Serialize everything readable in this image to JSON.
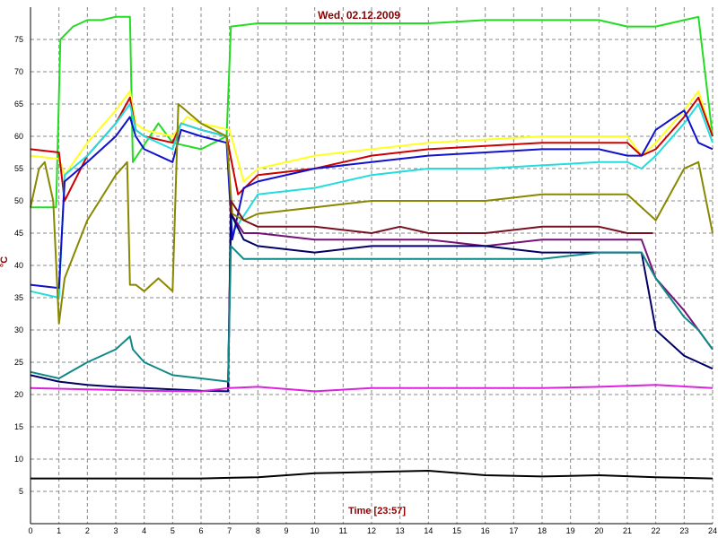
{
  "chart_data": {
    "type": "line",
    "title": "Wed, 02.12.2009",
    "xlabel": "Time [23:57]",
    "ylabel": "°C",
    "xlim": [
      0,
      24
    ],
    "ylim": [
      0,
      80
    ],
    "xticks": [
      "0",
      "1",
      "2",
      "3",
      "4",
      "5",
      "6",
      "7",
      "8",
      "9",
      "10",
      "11",
      "12",
      "13",
      "14",
      "15",
      "16",
      "17",
      "18",
      "19",
      "20",
      "21",
      "22",
      "23",
      "24"
    ],
    "yticks": [
      "5",
      "10",
      "15",
      "20",
      "25",
      "30",
      "35",
      "40",
      "45",
      "50",
      "55",
      "60",
      "65",
      "70",
      "75"
    ],
    "grid": true,
    "series": [
      {
        "color": "#22dd22",
        "x": [
          0,
          0.9,
          1.05,
          1.5,
          2,
          2.5,
          3,
          3.5,
          3.6,
          4.5,
          5,
          6,
          6.9,
          7.05,
          8,
          10,
          12,
          14,
          16,
          18,
          20,
          21,
          21.5,
          22,
          23,
          23.5,
          24
        ],
        "y": [
          49,
          49,
          75,
          77,
          78,
          78,
          78.5,
          78.5,
          56,
          62,
          59,
          58,
          60,
          77,
          77.5,
          77.5,
          77.5,
          77.5,
          78,
          78,
          78,
          77,
          77,
          77,
          78,
          78.5,
          60
        ]
      },
      {
        "color": "#ffff22",
        "x": [
          0,
          1,
          1.2,
          2,
          3,
          3.5,
          3.7,
          4,
          5,
          5.5,
          6,
          7,
          7.5,
          8,
          10,
          12,
          14,
          16,
          18,
          20,
          21,
          21.5,
          22,
          23,
          23.5,
          24
        ],
        "y": [
          57,
          56.5,
          54,
          59,
          64,
          67,
          62,
          61,
          60,
          63,
          62,
          61,
          53,
          55,
          57,
          58,
          59,
          59.5,
          60,
          60,
          60,
          57,
          59,
          64,
          67,
          60
        ]
      },
      {
        "color": "#cc0000",
        "x": [
          0,
          1,
          1.2,
          2,
          3,
          3.5,
          3.7,
          4,
          5,
          5.3,
          6,
          6.9,
          7.3,
          8,
          10,
          12,
          14,
          16,
          18,
          20,
          21,
          21.5,
          22,
          23,
          23.5,
          24
        ],
        "y": [
          58,
          57.5,
          50,
          57,
          62,
          66,
          61,
          60,
          59,
          62,
          61,
          60,
          51,
          54,
          55,
          57,
          58,
          58.5,
          59,
          59,
          59,
          57,
          58,
          63,
          66,
          60
        ]
      },
      {
        "color": "#22dddd",
        "x": [
          0,
          1,
          1.2,
          2,
          3,
          3.5,
          3.7,
          4,
          5,
          5.3,
          6,
          6.9,
          7.1,
          8,
          10,
          12,
          14,
          16,
          18,
          20,
          21,
          21.5,
          22,
          23,
          23.5,
          24
        ],
        "y": [
          36,
          35,
          54,
          57,
          62,
          65,
          61,
          60,
          58,
          62,
          61,
          60,
          45,
          51,
          52,
          54,
          55,
          55,
          55.5,
          56,
          56,
          55,
          57,
          62,
          65,
          59
        ]
      },
      {
        "color": "#1111cc",
        "x": [
          0,
          1,
          1.2,
          2,
          3,
          3.5,
          3.7,
          4,
          5,
          5.3,
          6,
          6.9,
          7.1,
          7.5,
          8,
          10,
          12,
          14,
          16,
          18,
          20,
          21,
          21.5,
          22,
          23,
          23.5,
          24
        ],
        "y": [
          37,
          36.5,
          53,
          56,
          60,
          63,
          60,
          58,
          56,
          61,
          60,
          59,
          44,
          52,
          53,
          55,
          56,
          57,
          57.5,
          58,
          58,
          57,
          57,
          61,
          64,
          59,
          58
        ]
      },
      {
        "color": "#888800",
        "x": [
          0,
          0.3,
          0.5,
          0.8,
          1,
          1.2,
          2,
          3,
          3.4,
          3.5,
          3.7,
          4,
          4.5,
          5,
          5.2,
          6,
          6.9,
          7.1,
          7.5,
          8,
          10,
          12,
          14,
          16,
          18,
          20,
          21,
          21.5,
          22,
          23,
          23.5,
          24
        ],
        "y": [
          49,
          55,
          56,
          50,
          31,
          38,
          47,
          54,
          56,
          37,
          37,
          36,
          38,
          36,
          65,
          62,
          60,
          48,
          47,
          48,
          49,
          50,
          50,
          50,
          51,
          51,
          51,
          49,
          47,
          55,
          56,
          45
        ]
      },
      {
        "color": "#771122",
        "x": [
          6.95,
          7.05,
          7.5,
          8,
          10,
          12,
          13,
          14,
          16,
          18,
          20,
          21,
          21.5,
          21.9
        ],
        "y": [
          21,
          50,
          47,
          46,
          46,
          45,
          46,
          45,
          45,
          46,
          46,
          45,
          45,
          45
        ]
      },
      {
        "color": "#771177",
        "x": [
          6.95,
          7.05,
          7.5,
          8,
          10,
          12,
          13,
          14,
          16,
          18,
          20,
          21,
          21.5,
          22,
          23,
          23.5,
          24
        ],
        "y": [
          21,
          48,
          45,
          45,
          44,
          44,
          44,
          44,
          43,
          44,
          44,
          44,
          44,
          38,
          33,
          30,
          27
        ]
      },
      {
        "color": "#000066",
        "x": [
          0,
          1,
          2,
          3,
          4,
          5,
          6,
          6.95,
          7.05,
          7.5,
          8,
          10,
          12,
          14,
          16,
          18,
          20,
          21,
          21.5,
          22,
          23,
          23.5,
          24
        ],
        "y": [
          23,
          22,
          21.5,
          21.2,
          21,
          20.8,
          20.6,
          20.5,
          48,
          44,
          43,
          42,
          43,
          43,
          43,
          42,
          42,
          42,
          42,
          30,
          26,
          25,
          24
        ]
      },
      {
        "color": "#118888",
        "x": [
          0,
          1,
          2,
          3,
          3.5,
          3.6,
          4,
          5,
          6,
          6.95,
          7.05,
          7.5,
          8,
          10,
          12,
          14,
          16,
          18,
          20,
          21,
          21.5,
          22,
          23,
          23.5,
          24
        ],
        "y": [
          23.5,
          22.5,
          25,
          27,
          29,
          27,
          25,
          23,
          22.5,
          22,
          43,
          41,
          41,
          41,
          41,
          41,
          41,
          41,
          42,
          42,
          42,
          38,
          32,
          30,
          27
        ]
      },
      {
        "color": "#dd22dd",
        "x": [
          0,
          2,
          4,
          6,
          7,
          8,
          10,
          12,
          14,
          16,
          18,
          20,
          22,
          24
        ],
        "y": [
          21,
          20.8,
          20.6,
          20.5,
          21,
          21.2,
          20.5,
          21,
          21,
          21,
          21,
          21.2,
          21.5,
          21
        ]
      },
      {
        "color": "#000000",
        "x": [
          0,
          2,
          4,
          6,
          8,
          10,
          12,
          14,
          16,
          18,
          20,
          22,
          24
        ],
        "y": [
          7,
          7,
          7,
          7,
          7.2,
          7.8,
          8,
          8.2,
          7.5,
          7.3,
          7.5,
          7.2,
          7
        ]
      }
    ]
  }
}
